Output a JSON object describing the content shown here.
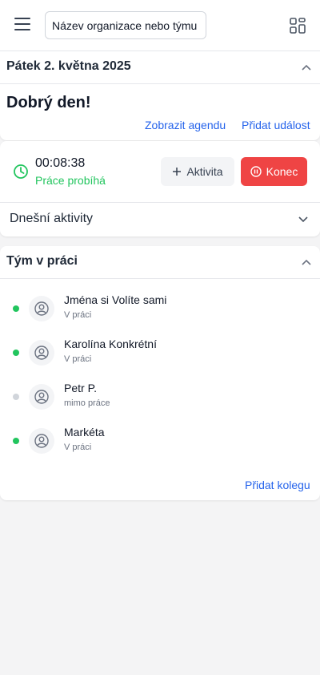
{
  "header": {
    "org_value": "Název organizace nebo týmu",
    "menu_icon": "hamburger-menu-icon",
    "apps_icon": "grid-apps-icon"
  },
  "today": {
    "date": "Pátek 2. května 2025",
    "greeting": "Dobrý den!",
    "show_agenda": "Zobrazit agendu",
    "add_event": "Přidat událost"
  },
  "work": {
    "timer": "00:08:38",
    "status": "Práce probíhá",
    "activity_button": "Aktivita",
    "end_button": "Konec",
    "today_activities": "Dnešní aktivity",
    "status_color": "#22c55e",
    "end_color": "#ef4444"
  },
  "team": {
    "title": "Tým v práci",
    "add_colleague": "Přidat kolegu",
    "members": [
      {
        "name": "Jména si Volíte sami",
        "status": "V práci",
        "online": true
      },
      {
        "name": "Karolína Konkrétní",
        "status": "V práci",
        "online": true
      },
      {
        "name": "Petr P.",
        "status": "mimo práce",
        "online": false
      },
      {
        "name": "Markéta",
        "status": "V práci",
        "online": true
      }
    ],
    "online_color": "#22c55e",
    "offline_color": "#d1d5db"
  }
}
